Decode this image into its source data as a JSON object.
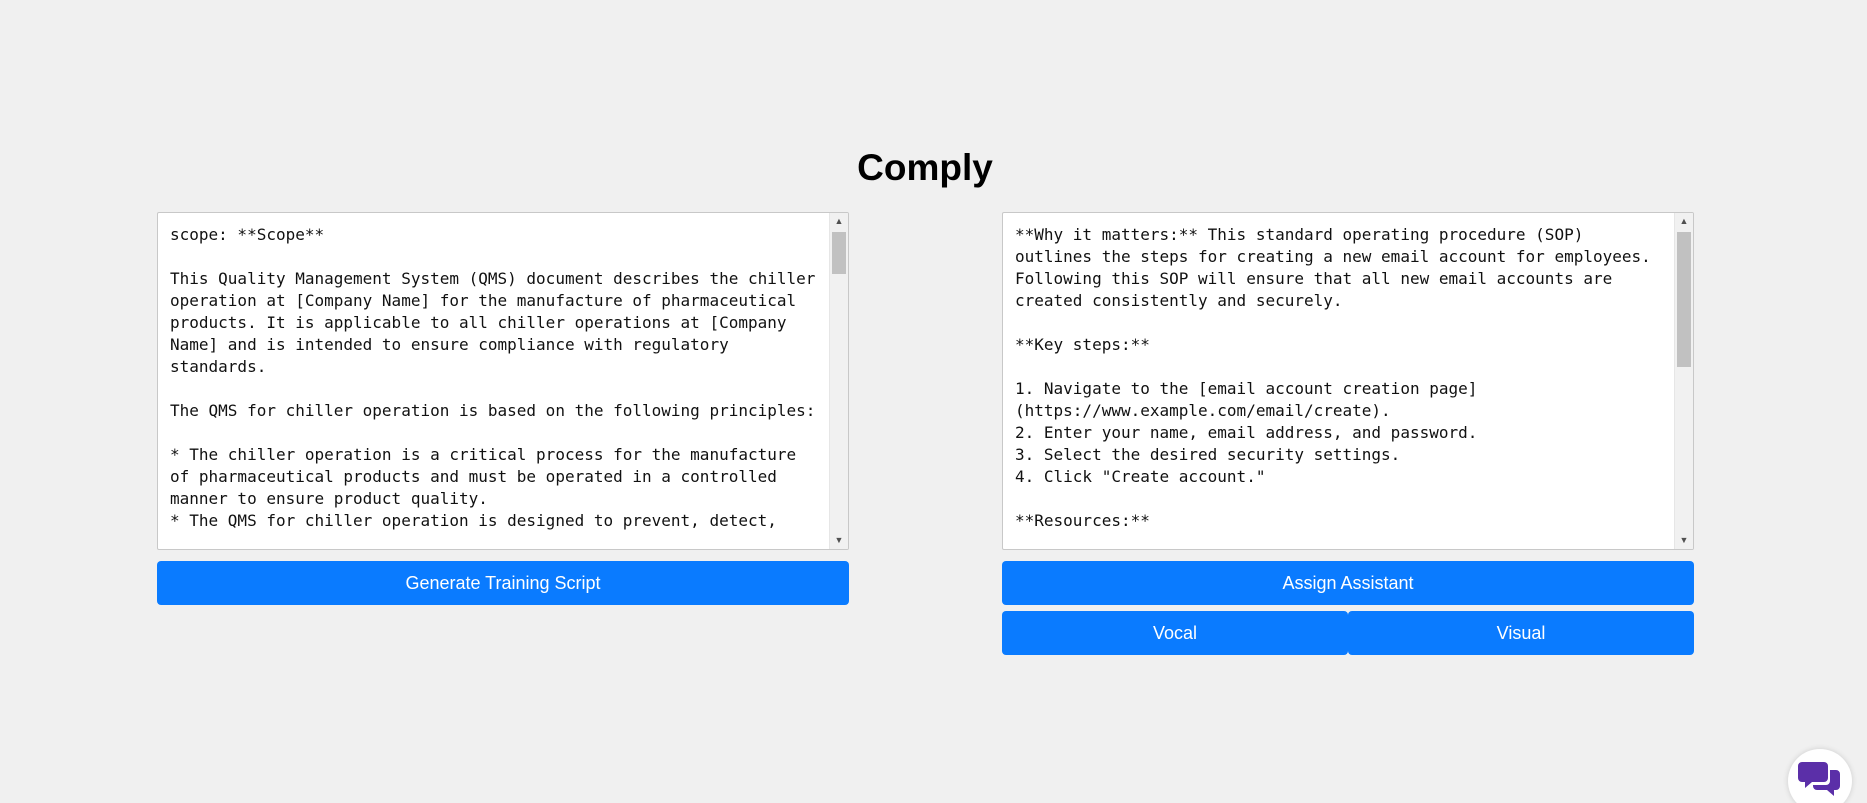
{
  "title": "Comply",
  "left_panel": {
    "text": "scope: **Scope**\n\nThis Quality Management System (QMS) document describes the chiller operation at [Company Name] for the manufacture of pharmaceutical products. It is applicable to all chiller operations at [Company Name] and is intended to ensure compliance with regulatory standards.\n\nThe QMS for chiller operation is based on the following principles:\n\n* The chiller operation is a critical process for the manufacture of pharmaceutical products and must be operated in a controlled manner to ensure product quality.\n* The QMS for chiller operation is designed to prevent, detect,",
    "button_label": "Generate Training Script"
  },
  "right_panel": {
    "text": "**Why it matters:** This standard operating procedure (SOP) outlines the steps for creating a new email account for employees. Following this SOP will ensure that all new email accounts are created consistently and securely.\n\n**Key steps:**\n\n1. Navigate to the [email account creation page](https://www.example.com/email/create).\n2. Enter your name, email address, and password.\n3. Select the desired security settings.\n4. Click \"Create account.\"\n\n**Resources:**",
    "assign_label": "Assign Assistant",
    "vocal_label": "Vocal",
    "visual_label": "Visual"
  },
  "colors": {
    "accent": "#0a7bff",
    "background": "#f0f0f0",
    "chat_icon": "#5b2fa8"
  },
  "icons": {
    "chat_widget": "chat-bubbles-icon"
  }
}
